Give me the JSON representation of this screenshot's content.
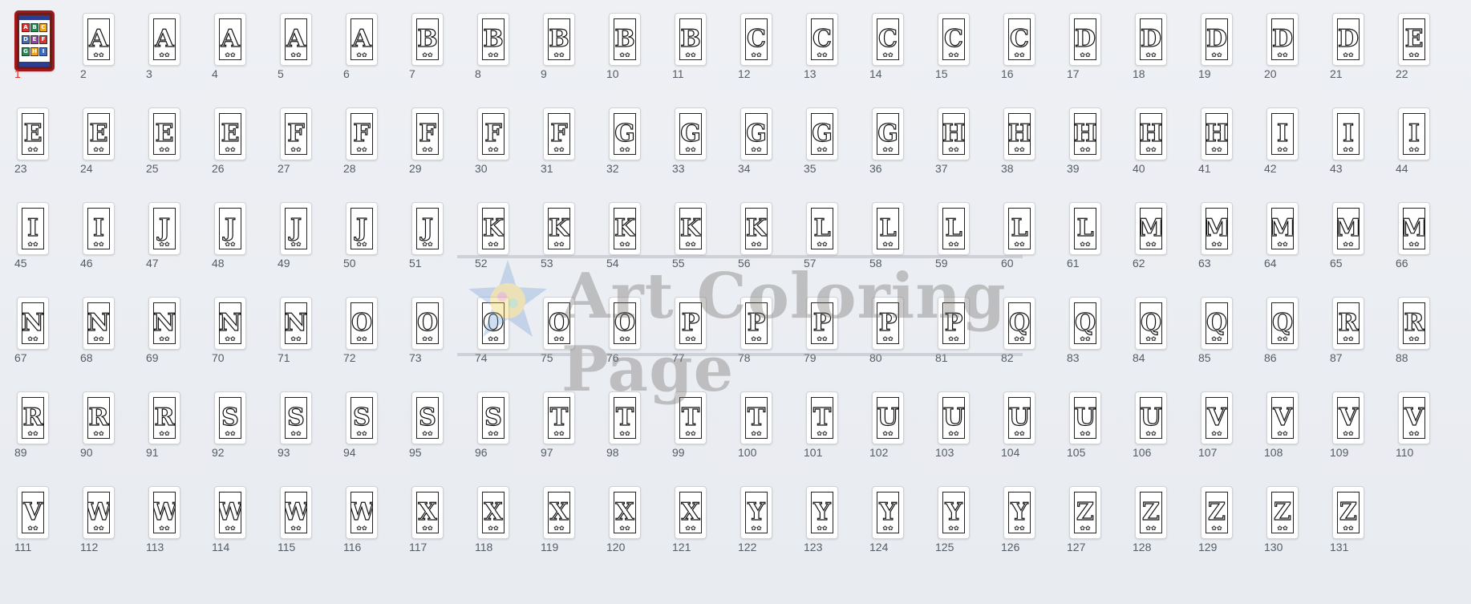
{
  "selected_index": 1,
  "accent_color": "#e0322b",
  "selection_border_color": "#a3161b",
  "cover": {
    "icon": "coloring-book-cover-icon",
    "tiles": [
      "A",
      "B",
      "C",
      "D",
      "E",
      "F",
      "G",
      "H",
      "I"
    ]
  },
  "watermark": {
    "text": "Art Coloring Page",
    "icon": "art-coloring-page-logo-icon"
  },
  "thumbnails": [
    {
      "label": "1",
      "letter": ""
    },
    {
      "label": "2",
      "letter": "A"
    },
    {
      "label": "3",
      "letter": "A"
    },
    {
      "label": "4",
      "letter": "A"
    },
    {
      "label": "5",
      "letter": "A"
    },
    {
      "label": "6",
      "letter": "A"
    },
    {
      "label": "7",
      "letter": "B"
    },
    {
      "label": "8",
      "letter": "B"
    },
    {
      "label": "9",
      "letter": "B"
    },
    {
      "label": "10",
      "letter": "B"
    },
    {
      "label": "11",
      "letter": "B"
    },
    {
      "label": "12",
      "letter": "C"
    },
    {
      "label": "13",
      "letter": "C"
    },
    {
      "label": "14",
      "letter": "C"
    },
    {
      "label": "15",
      "letter": "C"
    },
    {
      "label": "16",
      "letter": "C"
    },
    {
      "label": "17",
      "letter": "D"
    },
    {
      "label": "18",
      "letter": "D"
    },
    {
      "label": "19",
      "letter": "D"
    },
    {
      "label": "20",
      "letter": "D"
    },
    {
      "label": "21",
      "letter": "D"
    },
    {
      "label": "22",
      "letter": "E"
    },
    {
      "label": "23",
      "letter": "E"
    },
    {
      "label": "24",
      "letter": "E"
    },
    {
      "label": "25",
      "letter": "E"
    },
    {
      "label": "26",
      "letter": "E"
    },
    {
      "label": "27",
      "letter": "F"
    },
    {
      "label": "28",
      "letter": "F"
    },
    {
      "label": "29",
      "letter": "F"
    },
    {
      "label": "30",
      "letter": "F"
    },
    {
      "label": "31",
      "letter": "F"
    },
    {
      "label": "32",
      "letter": "G"
    },
    {
      "label": "33",
      "letter": "G"
    },
    {
      "label": "34",
      "letter": "G"
    },
    {
      "label": "35",
      "letter": "G"
    },
    {
      "label": "36",
      "letter": "G"
    },
    {
      "label": "37",
      "letter": "H"
    },
    {
      "label": "38",
      "letter": "H"
    },
    {
      "label": "39",
      "letter": "H"
    },
    {
      "label": "40",
      "letter": "H"
    },
    {
      "label": "41",
      "letter": "H"
    },
    {
      "label": "42",
      "letter": "I"
    },
    {
      "label": "43",
      "letter": "I"
    },
    {
      "label": "44",
      "letter": "I"
    },
    {
      "label": "45",
      "letter": "I"
    },
    {
      "label": "46",
      "letter": "I"
    },
    {
      "label": "47",
      "letter": "J"
    },
    {
      "label": "48",
      "letter": "J"
    },
    {
      "label": "49",
      "letter": "J"
    },
    {
      "label": "50",
      "letter": "J"
    },
    {
      "label": "51",
      "letter": "J"
    },
    {
      "label": "52",
      "letter": "K"
    },
    {
      "label": "53",
      "letter": "K"
    },
    {
      "label": "54",
      "letter": "K"
    },
    {
      "label": "55",
      "letter": "K"
    },
    {
      "label": "56",
      "letter": "K"
    },
    {
      "label": "57",
      "letter": "L"
    },
    {
      "label": "58",
      "letter": "L"
    },
    {
      "label": "59",
      "letter": "L"
    },
    {
      "label": "60",
      "letter": "L"
    },
    {
      "label": "61",
      "letter": "L"
    },
    {
      "label": "62",
      "letter": "M"
    },
    {
      "label": "63",
      "letter": "M"
    },
    {
      "label": "64",
      "letter": "M"
    },
    {
      "label": "65",
      "letter": "M"
    },
    {
      "label": "66",
      "letter": "M"
    },
    {
      "label": "67",
      "letter": "N"
    },
    {
      "label": "68",
      "letter": "N"
    },
    {
      "label": "69",
      "letter": "N"
    },
    {
      "label": "70",
      "letter": "N"
    },
    {
      "label": "71",
      "letter": "N"
    },
    {
      "label": "72",
      "letter": "O"
    },
    {
      "label": "73",
      "letter": "O"
    },
    {
      "label": "74",
      "letter": "O"
    },
    {
      "label": "75",
      "letter": "O"
    },
    {
      "label": "76",
      "letter": "O"
    },
    {
      "label": "77",
      "letter": "P"
    },
    {
      "label": "78",
      "letter": "P"
    },
    {
      "label": "79",
      "letter": "P"
    },
    {
      "label": "80",
      "letter": "P"
    },
    {
      "label": "81",
      "letter": "P"
    },
    {
      "label": "82",
      "letter": "Q"
    },
    {
      "label": "83",
      "letter": "Q"
    },
    {
      "label": "84",
      "letter": "Q"
    },
    {
      "label": "85",
      "letter": "Q"
    },
    {
      "label": "86",
      "letter": "Q"
    },
    {
      "label": "87",
      "letter": "R"
    },
    {
      "label": "88",
      "letter": "R"
    },
    {
      "label": "89",
      "letter": "R"
    },
    {
      "label": "90",
      "letter": "R"
    },
    {
      "label": "91",
      "letter": "R"
    },
    {
      "label": "92",
      "letter": "S"
    },
    {
      "label": "93",
      "letter": "S"
    },
    {
      "label": "94",
      "letter": "S"
    },
    {
      "label": "95",
      "letter": "S"
    },
    {
      "label": "96",
      "letter": "S"
    },
    {
      "label": "97",
      "letter": "T"
    },
    {
      "label": "98",
      "letter": "T"
    },
    {
      "label": "99",
      "letter": "T"
    },
    {
      "label": "100",
      "letter": "T"
    },
    {
      "label": "101",
      "letter": "T"
    },
    {
      "label": "102",
      "letter": "U"
    },
    {
      "label": "103",
      "letter": "U"
    },
    {
      "label": "104",
      "letter": "U"
    },
    {
      "label": "105",
      "letter": "U"
    },
    {
      "label": "106",
      "letter": "U"
    },
    {
      "label": "107",
      "letter": "V"
    },
    {
      "label": "108",
      "letter": "V"
    },
    {
      "label": "109",
      "letter": "V"
    },
    {
      "label": "110",
      "letter": "V"
    },
    {
      "label": "111",
      "letter": "V"
    },
    {
      "label": "112",
      "letter": "W"
    },
    {
      "label": "113",
      "letter": "W"
    },
    {
      "label": "114",
      "letter": "W"
    },
    {
      "label": "115",
      "letter": "W"
    },
    {
      "label": "116",
      "letter": "W"
    },
    {
      "label": "117",
      "letter": "X"
    },
    {
      "label": "118",
      "letter": "X"
    },
    {
      "label": "119",
      "letter": "X"
    },
    {
      "label": "120",
      "letter": "X"
    },
    {
      "label": "121",
      "letter": "X"
    },
    {
      "label": "122",
      "letter": "Y"
    },
    {
      "label": "123",
      "letter": "Y"
    },
    {
      "label": "124",
      "letter": "Y"
    },
    {
      "label": "125",
      "letter": "Y"
    },
    {
      "label": "126",
      "letter": "Y"
    },
    {
      "label": "127",
      "letter": "Z"
    },
    {
      "label": "128",
      "letter": "Z"
    },
    {
      "label": "129",
      "letter": "Z"
    },
    {
      "label": "130",
      "letter": "Z"
    },
    {
      "label": "131",
      "letter": "Z"
    }
  ]
}
